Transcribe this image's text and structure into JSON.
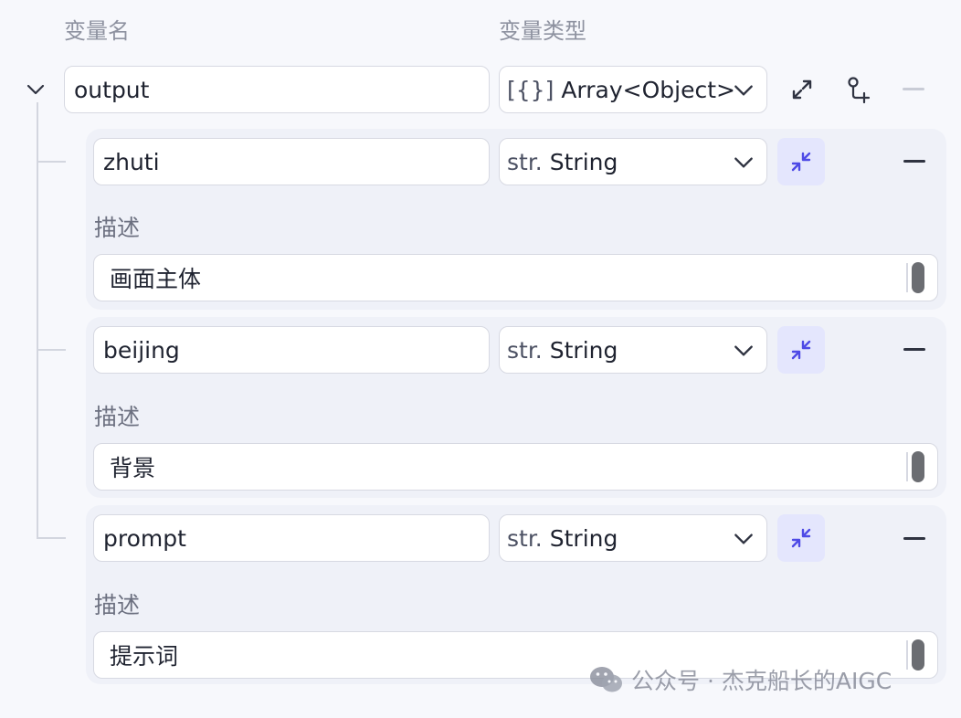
{
  "headers": {
    "name": "变量名",
    "type": "变量类型"
  },
  "output": {
    "name": "output",
    "type_icon": "[{}]",
    "type_label": "Array<Object>",
    "icons": [
      "chevron-down-icon",
      "expand-icon",
      "add-child-icon",
      "minus-icon"
    ]
  },
  "children": [
    {
      "name": "zhuti",
      "type_icon": "str.",
      "type_label": "String",
      "desc_label": "描述",
      "desc_value": "画面主体"
    },
    {
      "name": "beijing",
      "type_icon": "str.",
      "type_label": "String",
      "desc_label": "描述",
      "desc_value": "背景"
    },
    {
      "name": "prompt",
      "type_icon": "str.",
      "type_label": "String",
      "desc_label": "描述",
      "desc_value": "提示词"
    }
  ],
  "watermark": {
    "text": "公众号 · 杰克船长的AIGC",
    "icon": "wechat-icon"
  },
  "colors": {
    "accent": "#4e4ae6",
    "accent_bg": "#e4e6fd",
    "card_bg": "#eff1f8",
    "page_bg": "#f7f8fc"
  }
}
